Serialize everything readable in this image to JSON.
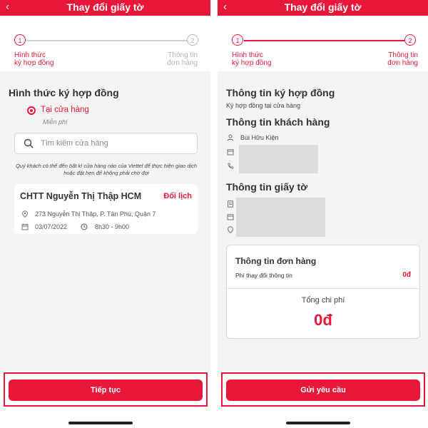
{
  "colors": {
    "accent": "#e8173a",
    "background": "#f4f4f4",
    "card": "#ffffff",
    "muted": "#b5b5b5",
    "home_bar": "#222222"
  },
  "icons": [
    "back-chevron-icon",
    "search-icon",
    "location-pin-icon",
    "calendar-icon",
    "clock-icon",
    "person-icon",
    "phone-icon",
    "document-icon"
  ],
  "left_screen": {
    "header": {
      "back": "‹",
      "title": "Thay đổi giấy tờ"
    },
    "stepper": {
      "step1": {
        "number": "1",
        "label_line1": "Hình thức",
        "label_line2": "ký hợp đồng"
      },
      "step2": {
        "number": "2",
        "label_line1": "Thông tin",
        "label_line2": "đơn hàng"
      }
    },
    "section_title": "Hình thức ký hợp đồng",
    "option": {
      "label": "Tại cửa hàng",
      "sub": "Miễn phí"
    },
    "search": {
      "placeholder": "Tìm kiếm cửa hàng"
    },
    "note": "Quý khách có thể đến bất kì cửa hàng nào của Viettel để thực hiện giao dịch hoặc đặt hẹn để không phải chờ đợi",
    "store": {
      "name": "CHTT Nguyễn Thị Thập HCM",
      "change_label": "Đổi lịch",
      "address": "273 Nguyễn Thị Thập, P. Tân Phú, Quận 7",
      "date": "03/07/2022",
      "time": "8h30 - 9h00"
    },
    "cta": "Tiếp tục"
  },
  "right_screen": {
    "header": {
      "back": "‹",
      "title": "Thay đổi giấy tờ"
    },
    "stepper": {
      "step1": {
        "number": "1",
        "label_line1": "Hình thức",
        "label_line2": "ký hợp đồng"
      },
      "step2": {
        "number": "2",
        "label_line1": "Thông tin",
        "label_line2": "đơn hàng"
      }
    },
    "contract_section": {
      "title": "Thông tin ký hợp đồng",
      "value": "Ký hợp đồng tại cửa hàng"
    },
    "customer_section": {
      "title": "Thông tin khách hàng",
      "name": "Bùi Hữu Kiện"
    },
    "document_section": {
      "title": "Thông tin giấy tờ"
    },
    "order": {
      "title": "Thông tin đơn hàng",
      "fee_label": "Phí thay đổi thông tin",
      "fee_value": "0đ",
      "total_label": "Tổng chi phí",
      "total_value": "0đ"
    },
    "cta": "Gửi yêu cầu"
  }
}
